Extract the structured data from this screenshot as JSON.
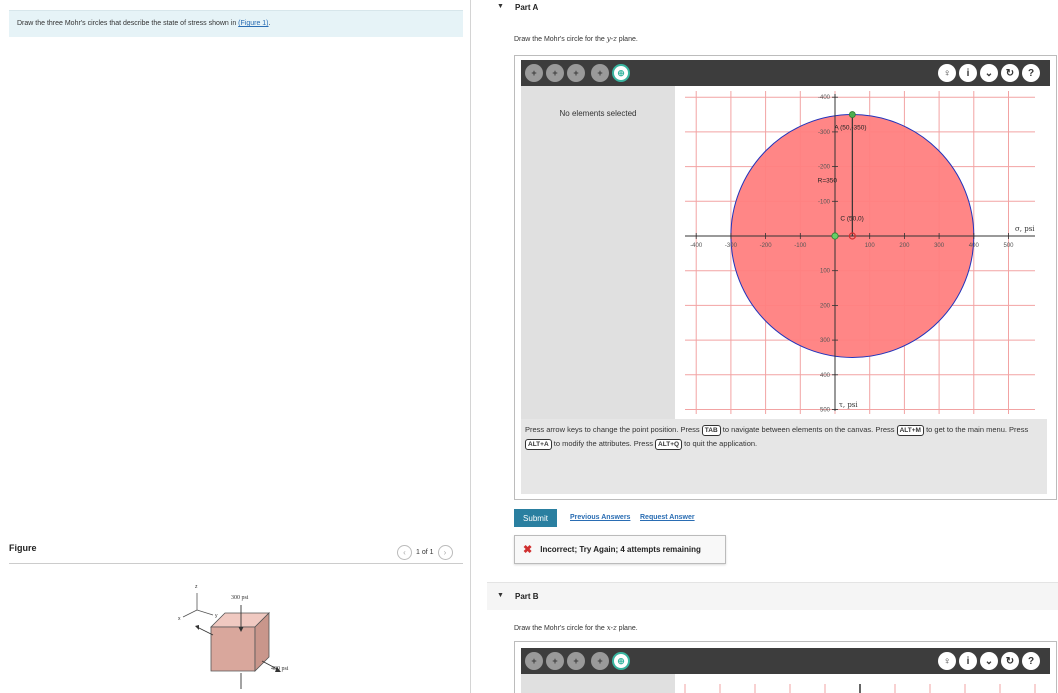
{
  "problem": {
    "text": "Draw the three Mohr's circles that describe the state of stress shown in",
    "link": "(Figure 1)",
    "end": "."
  },
  "figure": {
    "label": "Figure",
    "pager": "1 of 1",
    "prev_icon": "chevron-left-icon",
    "next_icon": "chevron-right-icon",
    "stress_top": "300 psi",
    "stress_side": "400 psi",
    "axis_z": "z",
    "axis_y": "y",
    "axis_x": "x"
  },
  "partA": {
    "header": "Part A",
    "instruction_pre": "Draw the Mohr's circle for the ",
    "instruction_plane": "y-z",
    "instruction_post": " plane.",
    "no_elements": "No elements selected",
    "help": {
      "t1": "Press arrow keys to change the point position. Press ",
      "k1": "TAB",
      "t2": " to navigate between elements on the canvas. Press ",
      "k2": "ALT+M",
      "t3": " to get to the main menu. Press ",
      "k3": "ALT+A",
      "t4": " to modify the attributes. Press ",
      "k4": "ALT+Q",
      "t5": " to quit the application."
    },
    "submit": "Submit",
    "prev_answers": "Previous Answers",
    "request_answer": "Request Answer",
    "feedback": "Incorrect; Try Again; 4 attempts remaining"
  },
  "partB": {
    "header": "Part B",
    "instruction_pre": "Draw the Mohr's circle for the ",
    "instruction_plane": "x-z",
    "instruction_post": " plane."
  },
  "toolbar": {
    "left_icons": [
      "point-icon",
      "circle-tool-icon",
      "center-tool-icon",
      "radius-tool-icon",
      "compass-tool-icon"
    ],
    "right_icons": [
      "hint-icon",
      "info-icon",
      "dropdown-icon",
      "reset-icon",
      "help-icon"
    ]
  },
  "graph": {
    "x_axis_label": "σ, psi",
    "y_axis_label": "τ, psi",
    "x_ticks": [
      "-400",
      "-300",
      "-200",
      "-100",
      "100",
      "200",
      "300",
      "400",
      "500"
    ],
    "y_ticks_up": [
      "-400",
      "-300",
      "-200",
      "-100"
    ],
    "y_ticks_down": [
      "100",
      "200",
      "300",
      "400",
      "500"
    ],
    "label_A": "A (50,-350)",
    "label_R": "R=350",
    "label_C": "C (50,0)",
    "circle_fill": "#ff7f7f",
    "circle_stroke": "#2233bb",
    "grid_color": "#f2a3a3",
    "point_A": [
      50,
      -350
    ],
    "center": [
      50,
      0
    ],
    "radius": 350
  }
}
